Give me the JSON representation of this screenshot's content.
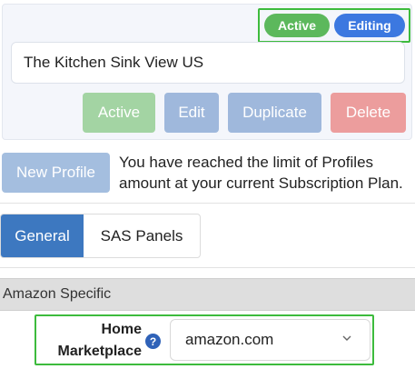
{
  "profile": {
    "status_badges": {
      "active": "Active",
      "editing": "Editing"
    },
    "name": "The Kitchen Sink View US",
    "actions": {
      "active": "Active",
      "edit": "Edit",
      "duplicate": "Duplicate",
      "delete": "Delete"
    }
  },
  "new_profile": {
    "button_label": "New Profile",
    "limit_message": "You have reached the limit of Profiles amount at your current Subscription Plan."
  },
  "tabs": [
    {
      "label": "General",
      "selected": true
    },
    {
      "label": "SAS Panels",
      "selected": false
    }
  ],
  "section": {
    "title": "Amazon Specific"
  },
  "marketplace": {
    "label_line1": "Home",
    "label_line2": "Marketplace",
    "help_icon": "?",
    "value": "amazon.com"
  },
  "colors": {
    "active_green": "#5cb85c",
    "editing_blue": "#3c78e0",
    "highlight_green": "#3dbb3d",
    "tab_selected": "#3d78c0",
    "delete_red": "#ec9d9d"
  },
  "icons": {
    "help": "question-circle-icon",
    "select_toggle": "chevron-down-icon"
  }
}
